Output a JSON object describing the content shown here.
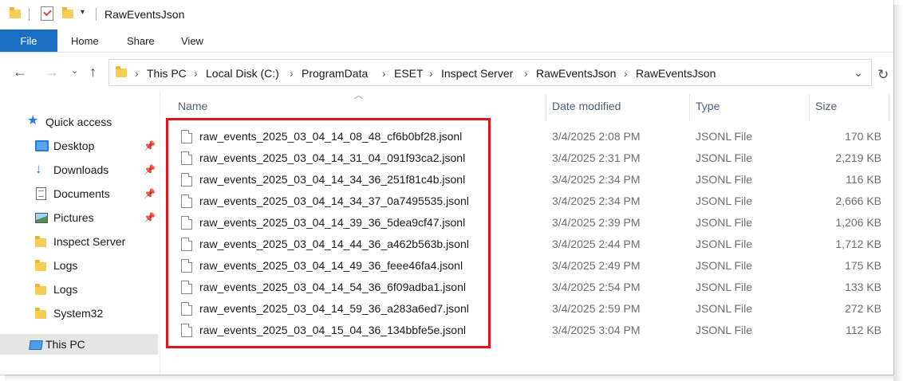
{
  "window": {
    "title": "RawEventsJson"
  },
  "ribbon": {
    "tabs": [
      "File",
      "Home",
      "Share",
      "View"
    ]
  },
  "address": {
    "crumbs": [
      "This PC",
      "Local Disk (C:)",
      "ProgramData",
      "ESET",
      "Inspect Server",
      "RawEventsJson",
      "RawEventsJson"
    ]
  },
  "sidebar": {
    "quick_access": "Quick access",
    "items": [
      {
        "label": "Desktop",
        "icon": "desktop-icon",
        "pinned": true
      },
      {
        "label": "Downloads",
        "icon": "downloads-icon",
        "pinned": true
      },
      {
        "label": "Documents",
        "icon": "documents-icon",
        "pinned": true
      },
      {
        "label": "Pictures",
        "icon": "pictures-icon",
        "pinned": true
      },
      {
        "label": "Inspect Server",
        "icon": "folder-icon",
        "pinned": false
      },
      {
        "label": "Logs",
        "icon": "folder-icon",
        "pinned": false
      },
      {
        "label": "Logs",
        "icon": "folder-icon",
        "pinned": false
      },
      {
        "label": "System32",
        "icon": "folder-icon",
        "pinned": false
      }
    ],
    "this_pc": "This PC"
  },
  "columns": {
    "name": "Name",
    "date": "Date modified",
    "type": "Type",
    "size": "Size"
  },
  "files": [
    {
      "name": "raw_events_2025_03_04_14_08_48_cf6b0bf28.jsonl",
      "date": "3/4/2025 2:08 PM",
      "type": "JSONL File",
      "size": "170 KB"
    },
    {
      "name": "raw_events_2025_03_04_14_31_04_091f93ca2.jsonl",
      "date": "3/4/2025 2:31 PM",
      "type": "JSONL File",
      "size": "2,219 KB"
    },
    {
      "name": "raw_events_2025_03_04_14_34_36_251f81c4b.jsonl",
      "date": "3/4/2025 2:34 PM",
      "type": "JSONL File",
      "size": "116 KB"
    },
    {
      "name": "raw_events_2025_03_04_14_34_37_0a7495535.jsonl",
      "date": "3/4/2025 2:34 PM",
      "type": "JSONL File",
      "size": "2,666 KB"
    },
    {
      "name": "raw_events_2025_03_04_14_39_36_5dea9cf47.jsonl",
      "date": "3/4/2025 2:39 PM",
      "type": "JSONL File",
      "size": "1,206 KB"
    },
    {
      "name": "raw_events_2025_03_04_14_44_36_a462b563b.jsonl",
      "date": "3/4/2025 2:44 PM",
      "type": "JSONL File",
      "size": "1,712 KB"
    },
    {
      "name": "raw_events_2025_03_04_14_49_36_feee46fa4.jsonl",
      "date": "3/4/2025 2:49 PM",
      "type": "JSONL File",
      "size": "175 KB"
    },
    {
      "name": "raw_events_2025_03_04_14_54_36_6f09adba1.jsonl",
      "date": "3/4/2025 2:54 PM",
      "type": "JSONL File",
      "size": "133 KB"
    },
    {
      "name": "raw_events_2025_03_04_14_59_36_a283a6ed7.jsonl",
      "date": "3/4/2025 2:59 PM",
      "type": "JSONL File",
      "size": "272 KB"
    },
    {
      "name": "raw_events_2025_03_04_15_04_36_134bbfe5e.jsonl",
      "date": "3/4/2025 3:04 PM",
      "type": "JSONL File",
      "size": "112 KB"
    }
  ],
  "colors": {
    "accent": "#1a6fc2",
    "highlight_box": "#e1141b",
    "folder": "#f6cd57"
  }
}
